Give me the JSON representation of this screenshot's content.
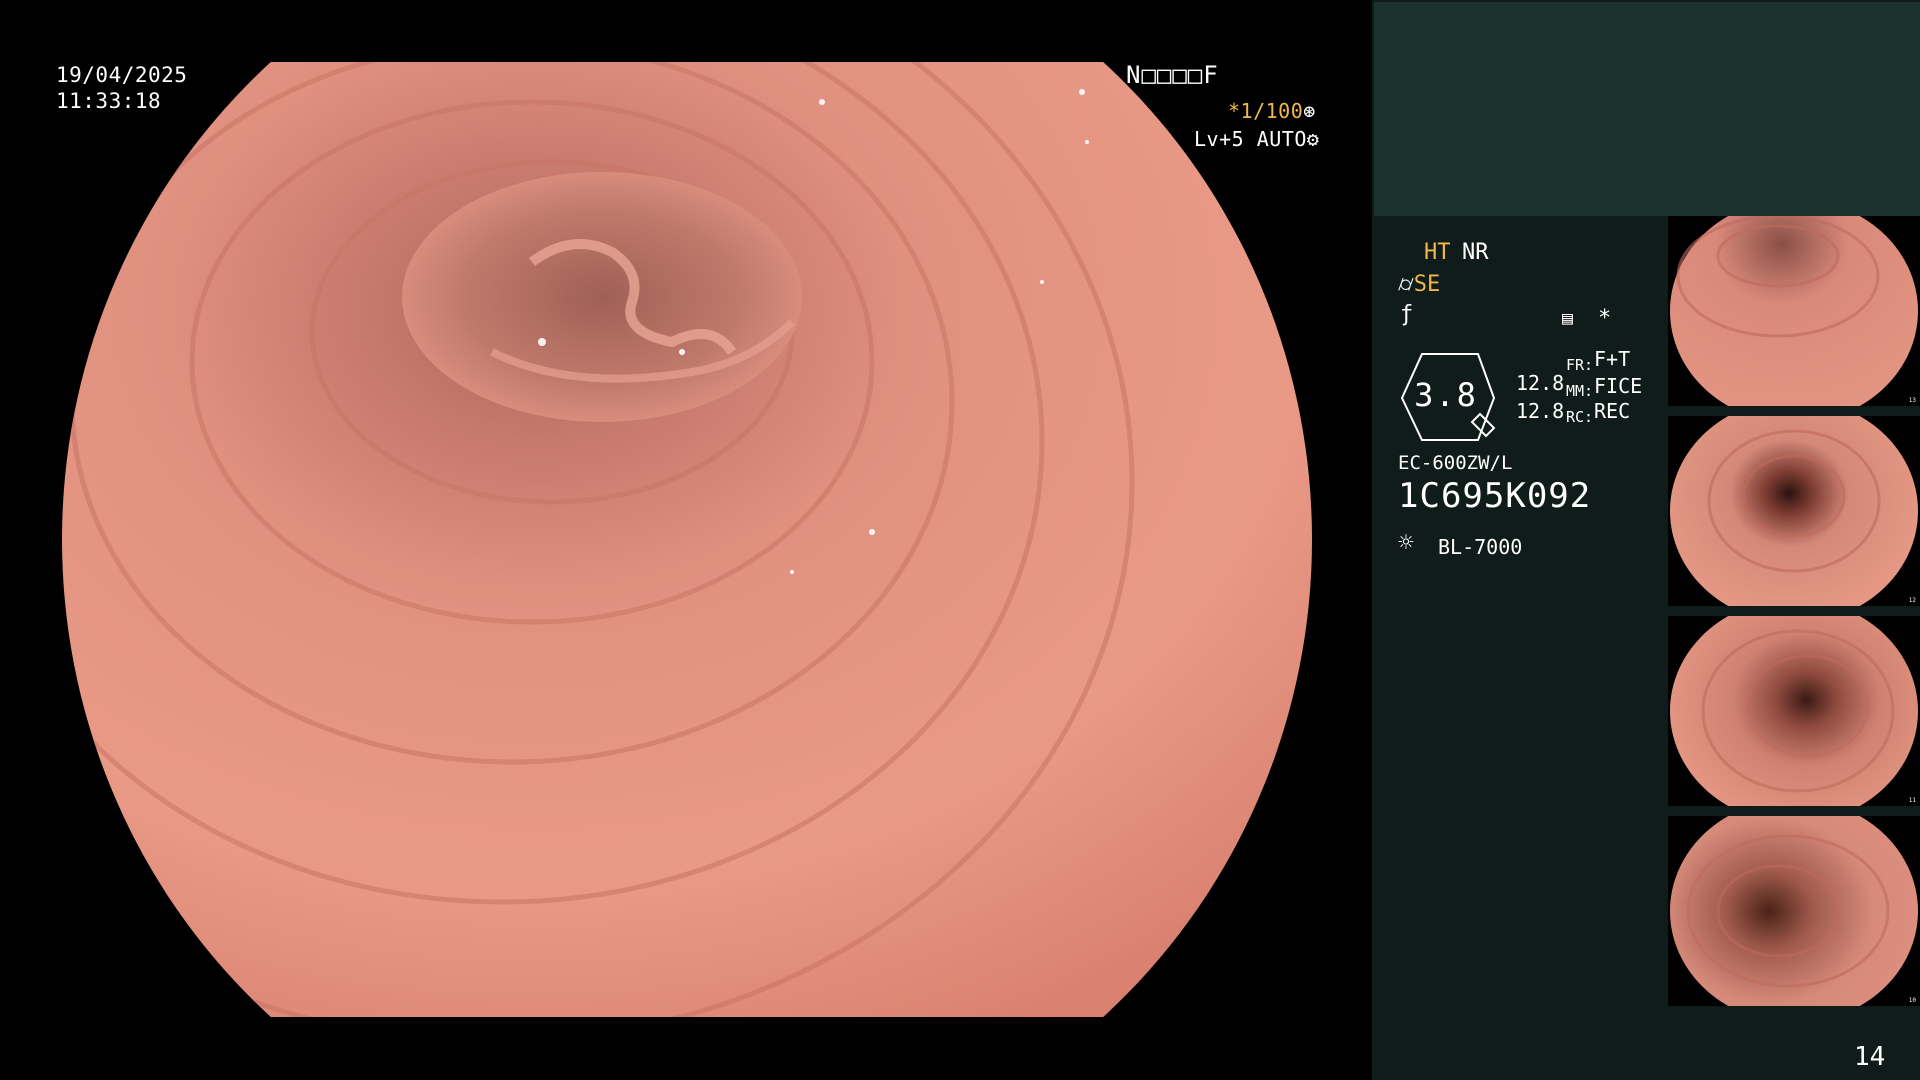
{
  "main_view": {
    "date": "19/04/2025",
    "time": "11:33:18",
    "code": "N□□□□F",
    "shutter": "*1/100",
    "level": "Lv+5 AUTO"
  },
  "side_panel": {
    "mode_ht": "HT",
    "mode_nr": "NR",
    "se_label": "SE",
    "hex_value": "3.8",
    "val1": "12.8",
    "val2": "12.8",
    "fr_label": "FR:",
    "fr_value": "F+T",
    "mm_label": "MM:",
    "mm_value": "FICE",
    "rc_label": "RC:",
    "rc_value": "REC",
    "scope_model": "EC-600ZW/L",
    "scope_serial": "1C695K092",
    "light_source": "BL-7000",
    "page_number": "14"
  },
  "thumbnails": [
    {
      "number": "13"
    },
    {
      "number": "12"
    },
    {
      "number": "11"
    },
    {
      "number": "10"
    }
  ],
  "colors": {
    "osd_accent": "#f0b84c",
    "panel_bg": "#0f1c1a",
    "panel_top": "#1a332f",
    "mucosa": "#e08878"
  },
  "icons": {
    "shutter_icon": "aperture-icon",
    "level_icon": "gear-icon",
    "light_icon": "sun-icon"
  }
}
